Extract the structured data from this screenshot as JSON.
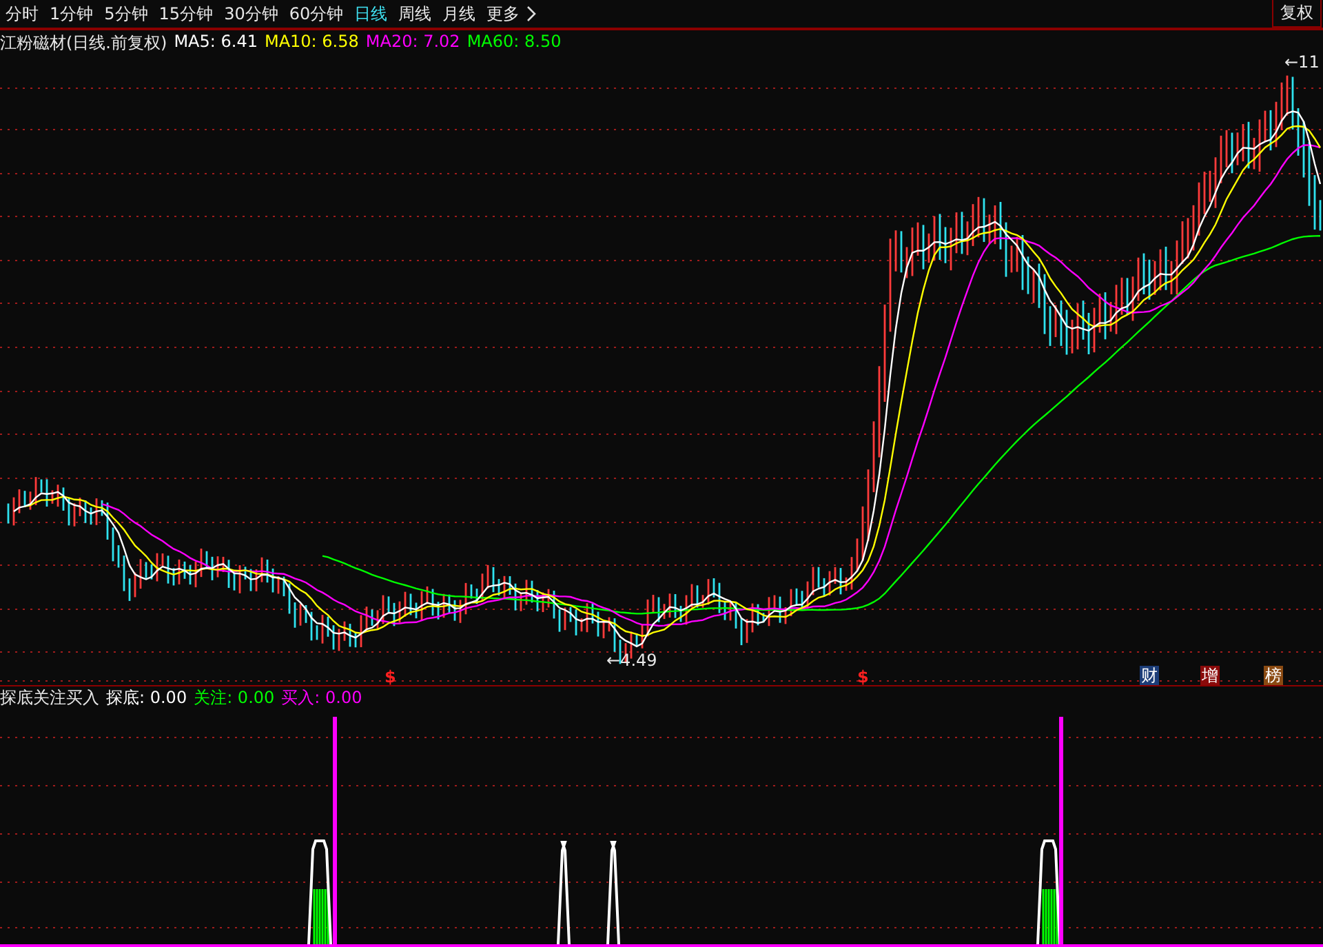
{
  "toolbar": {
    "periods": [
      {
        "label": "分时",
        "selected": false
      },
      {
        "label": "1分钟",
        "selected": false
      },
      {
        "label": "5分钟",
        "selected": false
      },
      {
        "label": "15分钟",
        "selected": false
      },
      {
        "label": "30分钟",
        "selected": false
      },
      {
        "label": "60分钟",
        "selected": false
      },
      {
        "label": "日线",
        "selected": true
      },
      {
        "label": "周线",
        "selected": false
      },
      {
        "label": "月线",
        "selected": false
      }
    ],
    "more": "更多",
    "restore_button": "复权"
  },
  "main_chart": {
    "title": "江粉磁材(日线.前复权)",
    "indicators": [
      {
        "label": "MA5: 6.41",
        "color": "#ffffff"
      },
      {
        "label": "MA10: 6.58",
        "color": "#ffff00"
      },
      {
        "label": "MA20: 7.02",
        "color": "#ff00ff"
      },
      {
        "label": "MA60: 8.50",
        "color": "#00ff00"
      }
    ],
    "high_label": "←11",
    "low_label": "←4.49",
    "signal_markers": [
      {
        "symbol": "$"
      },
      {
        "symbol": "$"
      }
    ],
    "event_badges": [
      {
        "label": "财",
        "color": "#1c3d78"
      },
      {
        "label": "增",
        "color": "#8a0a0a"
      },
      {
        "label": "榜",
        "color": "#8a4a12"
      }
    ]
  },
  "indicator_panel": {
    "title": "探底关注买入",
    "values": [
      {
        "label": "探底: 0.00",
        "color": "#ffffff"
      },
      {
        "label": "关注: 0.00",
        "color": "#00ff00"
      },
      {
        "label": "买入: 0.00",
        "color": "#ff00ff"
      }
    ]
  }
}
